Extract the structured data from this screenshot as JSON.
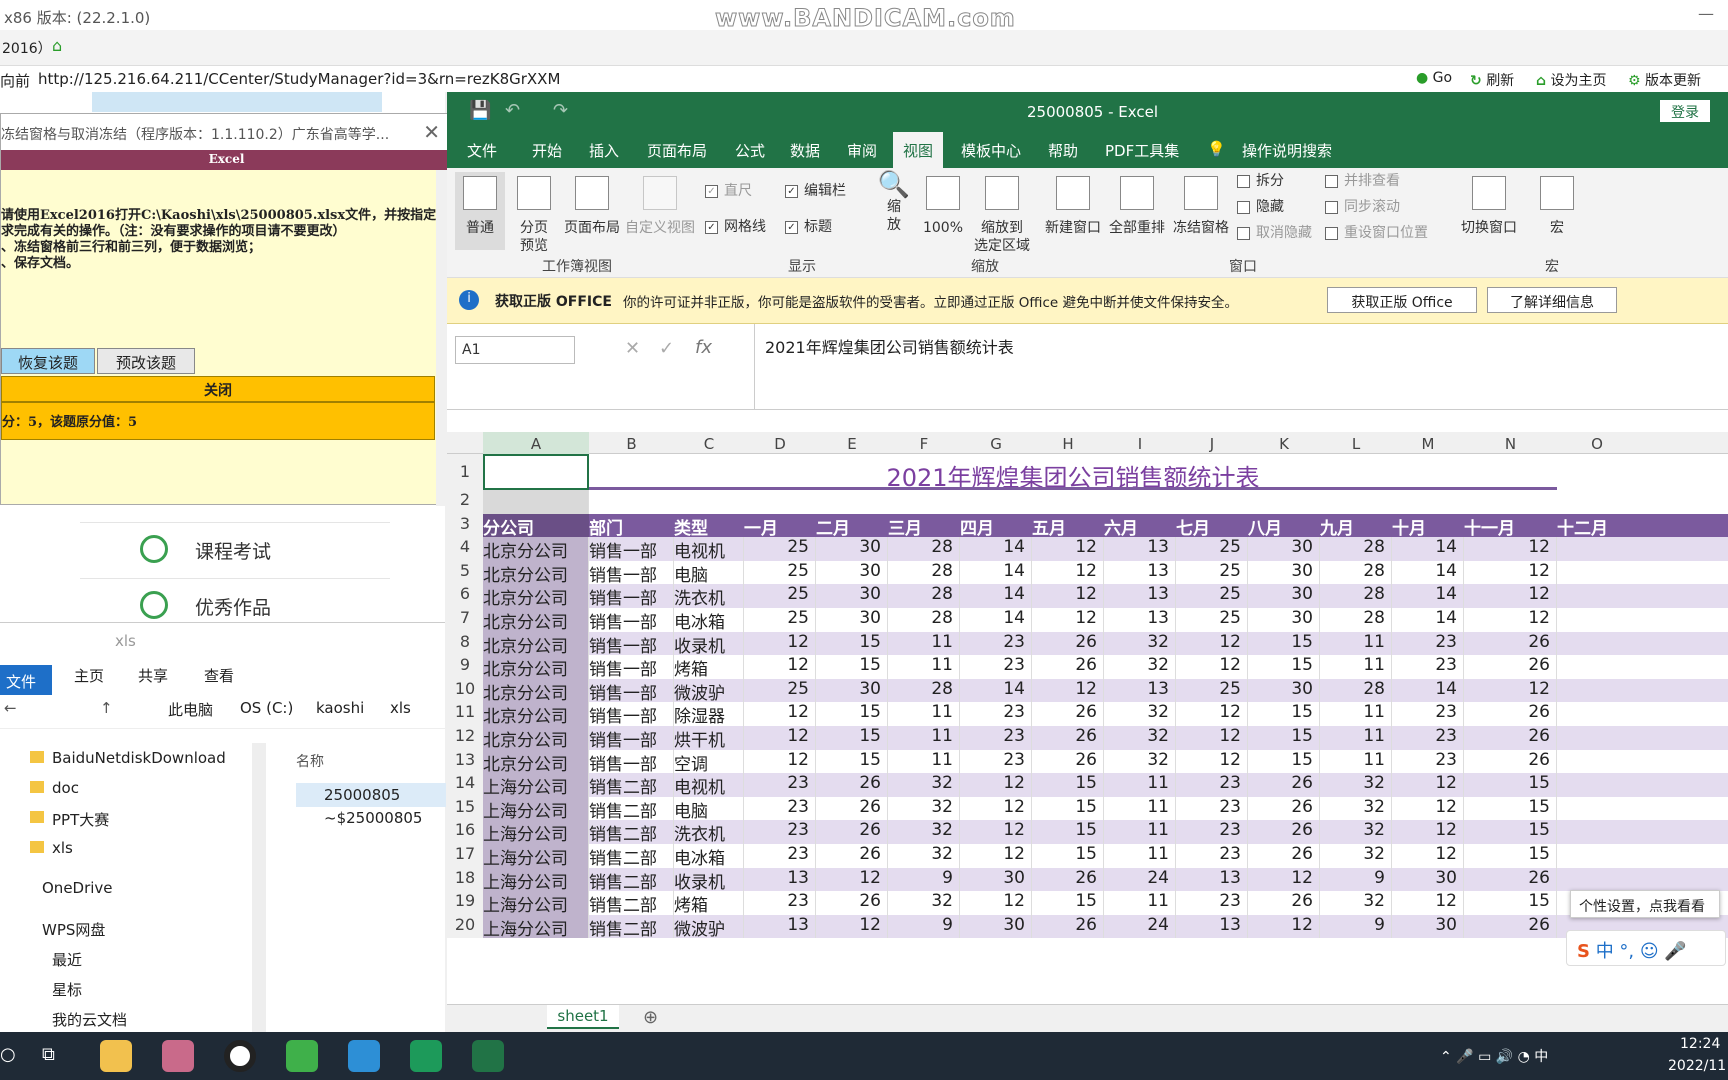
{
  "browser": {
    "title": "x86 版本: (22.2.1.0)",
    "watermark": "www.BANDICAM.com",
    "tab_label": "2016）",
    "addr_prefix": "向前",
    "url": "http://125.216.64.211/CCenter/StudyManager?id=3&rn=rezK8GrXXM",
    "go": "Go",
    "refresh": "刷新",
    "homepage": "设为主页",
    "update": "版本更新"
  },
  "web": {
    "exam": "课程考试",
    "works": "优秀作品"
  },
  "dialog": {
    "title": "冻结窗格与取消冻结（程序版本：1.1.110.2）广东省高等学...",
    "header": "Excel",
    "body": "请使用Excel2016打开C:\\Kaoshi\\xls\\25000805.xlsx文件，并按指定要\n求完成有关的操作。（注：没有要求操作的项目请不要更改）\n、冻结窗格前三行和前三列，便于数据浏览；\n、保存文档。",
    "restore": "恢复该题",
    "preview": "预改该题",
    "close": "关闭",
    "score": "分：5，该题原分值：5"
  },
  "explorer": {
    "folder": "xls",
    "tabs": [
      "文件",
      "主页",
      "共享",
      "查看"
    ],
    "path": [
      "此电脑",
      "OS (C:)",
      "kaoshi",
      "xls"
    ],
    "tree": [
      "BaiduNetdiskDownload",
      "doc",
      "PPT大赛",
      "xls",
      "OneDrive",
      "WPS网盘",
      "最近",
      "星标",
      "我的云文档"
    ],
    "col_name": "名称",
    "files": [
      "25000805",
      "~$25000805"
    ]
  },
  "excel": {
    "title": "25000805  -  Excel",
    "login": "登录",
    "menu": [
      "文件",
      "开始",
      "插入",
      "页面布局",
      "公式",
      "数据",
      "审阅",
      "视图",
      "模板中心",
      "帮助",
      "PDF工具集",
      "操作说明搜索"
    ],
    "ribbon": {
      "normal": "普通",
      "pagebreak": "分页\n预览",
      "pagelayout": "页面布局",
      "custom": "自定义视图",
      "g1": "工作簿视图",
      "ruler": "直尺",
      "formulabar": "编辑栏",
      "gridlines": "网格线",
      "headings": "标题",
      "g2": "显示",
      "zoom": "缩\n放",
      "z100": "100%",
      "zoomsel": "缩放到\n选定区域",
      "g3": "缩放",
      "newwin": "新建窗口",
      "arrange": "全部重排",
      "freeze": "冻结窗格",
      "split": "拆分",
      "hide": "隐藏",
      "unhide": "取消隐藏",
      "side": "并排查看",
      "sync": "同步滚动",
      "reset": "重设窗口位置",
      "g4": "窗口",
      "switch": "切换窗口",
      "macro": "宏",
      "g5": "宏"
    },
    "notice": {
      "title": "获取正版 OFFICE",
      "text": "你的许可证并非正版，你可能是盗版软件的受害者。立即通过正版 Office 避免中断并使文件保持安全。",
      "btn1": "获取正版 Office",
      "btn2": "了解详细信息"
    },
    "namebox": "A1",
    "formula": "2021年辉煌集团公司销售额统计表",
    "columns": [
      "A",
      "B",
      "C",
      "D",
      "E",
      "F",
      "G",
      "H",
      "I",
      "J",
      "K",
      "L",
      "M",
      "N",
      "O"
    ],
    "sheet_title": "2021年辉煌集团公司销售额统计表",
    "headers": [
      "分公司",
      "部门",
      "类型",
      "一月",
      "二月",
      "三月",
      "四月",
      "五月",
      "六月",
      "七月",
      "八月",
      "九月",
      "十月",
      "十一月",
      "十二月"
    ],
    "rows": [
      [
        "北京分公司",
        "销售一部",
        "电视机",
        "25",
        "30",
        "28",
        "14",
        "12",
        "13",
        "25",
        "30",
        "28",
        "14",
        "12"
      ],
      [
        "北京分公司",
        "销售一部",
        "电脑",
        "25",
        "30",
        "28",
        "14",
        "12",
        "13",
        "25",
        "30",
        "28",
        "14",
        "12"
      ],
      [
        "北京分公司",
        "销售一部",
        "洗衣机",
        "25",
        "30",
        "28",
        "14",
        "12",
        "13",
        "25",
        "30",
        "28",
        "14",
        "12"
      ],
      [
        "北京分公司",
        "销售一部",
        "电冰箱",
        "25",
        "30",
        "28",
        "14",
        "12",
        "13",
        "25",
        "30",
        "28",
        "14",
        "12"
      ],
      [
        "北京分公司",
        "销售一部",
        "收录机",
        "12",
        "15",
        "11",
        "23",
        "26",
        "32",
        "12",
        "15",
        "11",
        "23",
        "26"
      ],
      [
        "北京分公司",
        "销售一部",
        "烤箱",
        "12",
        "15",
        "11",
        "23",
        "26",
        "32",
        "12",
        "15",
        "11",
        "23",
        "26"
      ],
      [
        "北京分公司",
        "销售一部",
        "微波驴",
        "25",
        "30",
        "28",
        "14",
        "12",
        "13",
        "25",
        "30",
        "28",
        "14",
        "12"
      ],
      [
        "北京分公司",
        "销售一部",
        "除湿器",
        "12",
        "15",
        "11",
        "23",
        "26",
        "32",
        "12",
        "15",
        "11",
        "23",
        "26"
      ],
      [
        "北京分公司",
        "销售一部",
        "烘干机",
        "12",
        "15",
        "11",
        "23",
        "26",
        "32",
        "12",
        "15",
        "11",
        "23",
        "26"
      ],
      [
        "北京分公司",
        "销售一部",
        "空调",
        "12",
        "15",
        "11",
        "23",
        "26",
        "32",
        "12",
        "15",
        "11",
        "23",
        "26"
      ],
      [
        "上海分公司",
        "销售二部",
        "电视机",
        "23",
        "26",
        "32",
        "12",
        "15",
        "11",
        "23",
        "26",
        "32",
        "12",
        "15"
      ],
      [
        "上海分公司",
        "销售二部",
        "电脑",
        "23",
        "26",
        "32",
        "12",
        "15",
        "11",
        "23",
        "26",
        "32",
        "12",
        "15"
      ],
      [
        "上海分公司",
        "销售二部",
        "洗衣机",
        "23",
        "26",
        "32",
        "12",
        "15",
        "11",
        "23",
        "26",
        "32",
        "12",
        "15"
      ],
      [
        "上海分公司",
        "销售二部",
        "电冰箱",
        "23",
        "26",
        "32",
        "12",
        "15",
        "11",
        "23",
        "26",
        "32",
        "12",
        "15"
      ],
      [
        "上海分公司",
        "销售二部",
        "收录机",
        "13",
        "12",
        "9",
        "30",
        "26",
        "24",
        "13",
        "12",
        "9",
        "30",
        "26"
      ],
      [
        "上海分公司",
        "销售二部",
        "烤箱",
        "23",
        "26",
        "32",
        "12",
        "15",
        "11",
        "23",
        "26",
        "32",
        "12",
        "15"
      ],
      [
        "上海分公司",
        "销售二部",
        "微波驴",
        "13",
        "12",
        "9",
        "30",
        "26",
        "24",
        "13",
        "12",
        "9",
        "30",
        "26"
      ]
    ],
    "sheet": "sheet1"
  },
  "ime": {
    "popup": "个性设置，点我看看",
    "bar": "中 °, ☺ 🎤"
  },
  "taskbar": {
    "time": "12:24",
    "date": "2022/11"
  },
  "colors": {
    "excel_green": "#217346",
    "header_purple": "#7b5a9e",
    "band": "#e4dcef"
  }
}
